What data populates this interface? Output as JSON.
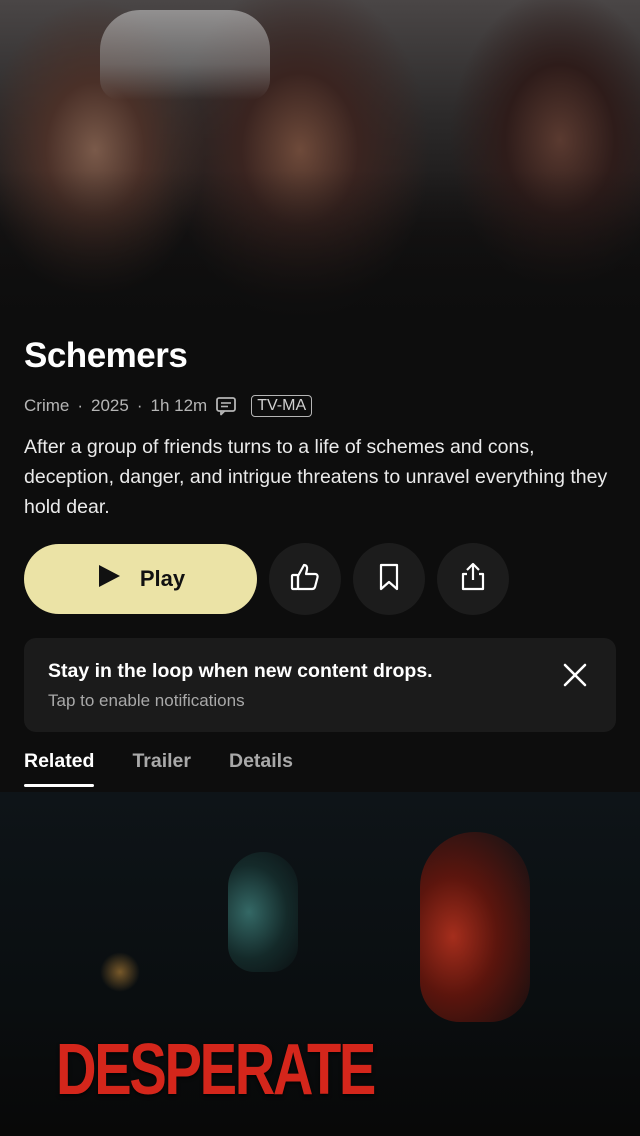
{
  "show": {
    "title": "Schemers",
    "genre": "Crime",
    "year": "2025",
    "duration": "1h 12m",
    "rating": "TV-MA",
    "synopsis": "After a group of friends turns to a life of schemes and cons, deception, danger, and intrigue threatens to unravel everything they hold dear."
  },
  "meta_separator": "·",
  "actions": {
    "play_label": "Play",
    "icons": [
      "play-icon",
      "thumbs-up-icon",
      "bookmark-icon",
      "share-icon",
      "closed-captions-icon",
      "close-icon"
    ]
  },
  "notification": {
    "title": "Stay in the loop when new content drops.",
    "subtitle": "Tap to enable notifications"
  },
  "tabs": [
    {
      "label": "Related",
      "active": true
    },
    {
      "label": "Trailer",
      "active": false
    },
    {
      "label": "Details",
      "active": false
    }
  ],
  "related": {
    "poster_title": "DESPERATE"
  },
  "colors": {
    "background": "#0d0d0d",
    "play_button": "#ebe3a6",
    "card": "#1b1b1b",
    "poster_title": "#d4261b"
  }
}
